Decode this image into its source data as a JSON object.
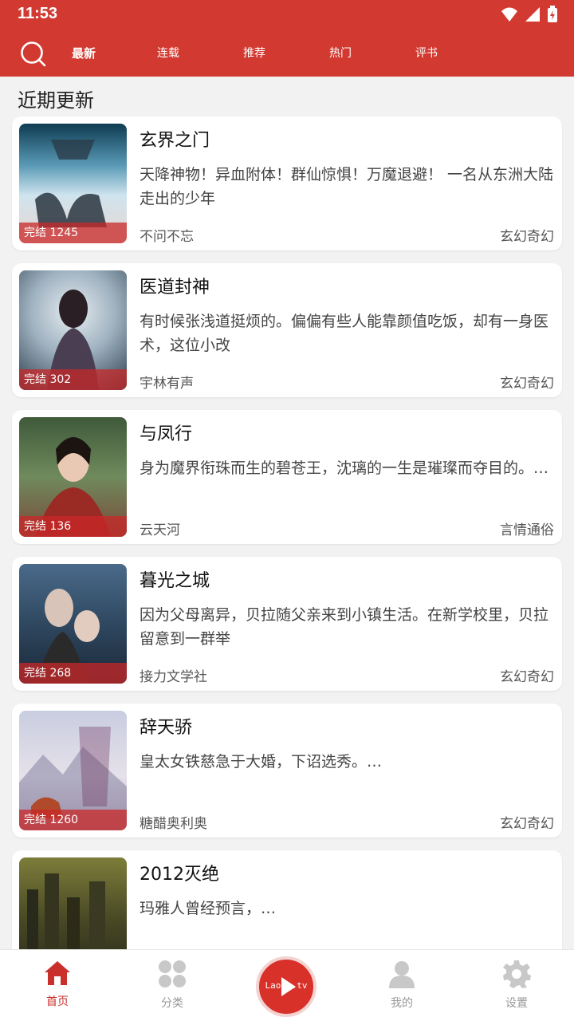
{
  "status_bar": {
    "time": "11:53"
  },
  "top_nav": {
    "tabs": [
      {
        "label": "最新"
      },
      {
        "label": "连载"
      },
      {
        "label": "推荐"
      },
      {
        "label": "热门"
      },
      {
        "label": "评书"
      }
    ]
  },
  "section": {
    "title": "近期更新"
  },
  "books": [
    {
      "title": "玄界之门",
      "desc": "天降神物！异血附体！群仙惊惧！万魔退避！ 一名从东洲大陆走出的少年",
      "author": "不问不忘",
      "genre": "玄幻奇幻",
      "badge": "完结 1245"
    },
    {
      "title": "医道封神",
      "desc": "有时候张浅道挺烦的。偏偏有些人能靠颜值吃饭，却有一身医术，这位小改",
      "author": "宇林有声",
      "genre": "玄幻奇幻",
      "badge": "完结 302"
    },
    {
      "title": "与凤行",
      "desc": "身为魔界衔珠而生的碧苍王，沈璃的一生是璀璨而夺目的。…",
      "author": "云天河",
      "genre": "言情通俗",
      "badge": "完结 136"
    },
    {
      "title": "暮光之城",
      "desc": "因为父母离异，贝拉随父亲来到小镇生活。在新学校里，贝拉留意到一群举",
      "author": "接力文学社",
      "genre": "玄幻奇幻",
      "badge": "完结 268"
    },
    {
      "title": "辞天骄",
      "desc": "皇太女铁慈急于大婚，下诏选秀。…",
      "author": "糖醋奥利奥",
      "genre": "玄幻奇幻",
      "badge": "完结 1260"
    },
    {
      "title": "2012灭绝",
      "desc": "玛雅人曾经预言，…",
      "author": "",
      "genre": "",
      "badge": ""
    }
  ],
  "bottom_nav": {
    "home": "首页",
    "category": "分类",
    "center_logo": "Laohu.tv",
    "mine": "我的",
    "settings": "设置"
  },
  "colors": {
    "accent": "#d23a31",
    "active_tab_text": "#c9302c"
  }
}
